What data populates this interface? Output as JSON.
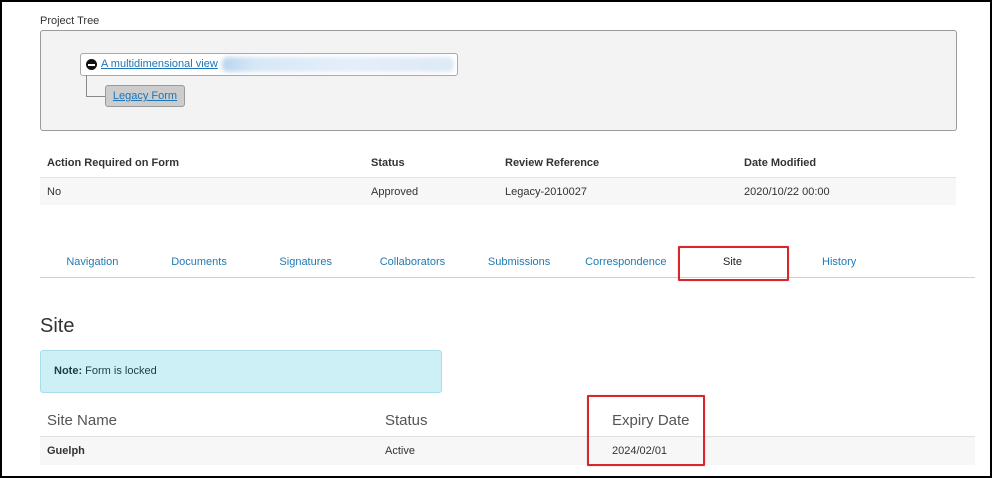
{
  "project_tree": {
    "label": "Project Tree",
    "root": {
      "label": "A multidimensional view",
      "icon": "minus-circle-icon"
    },
    "child": {
      "label": "Legacy Form"
    }
  },
  "form_summary": {
    "headers": [
      "Action Required on Form",
      "Status",
      "Review Reference",
      "Date Modified"
    ],
    "rows": [
      [
        "No",
        "Approved",
        "Legacy-2010027",
        "2020/10/22 00:00"
      ]
    ]
  },
  "tabs": [
    {
      "label": "Navigation",
      "active": false
    },
    {
      "label": "Documents",
      "active": false
    },
    {
      "label": "Signatures",
      "active": false
    },
    {
      "label": "Collaborators",
      "active": false
    },
    {
      "label": "Submissions",
      "active": false
    },
    {
      "label": "Correspondence",
      "active": false
    },
    {
      "label": "Site",
      "active": true
    },
    {
      "label": "History",
      "active": false
    }
  ],
  "site": {
    "title": "Site",
    "note": {
      "label": "Note:",
      "text": "Form is locked"
    },
    "table": {
      "headers": [
        "Site Name",
        "Status",
        "Expiry Date"
      ],
      "rows": [
        [
          "Guelph",
          "Active",
          "2024/02/01"
        ]
      ]
    }
  },
  "colors": {
    "link": "#1b75b8",
    "tab_text": "#1f7ab3",
    "active_tab_text": "#222222",
    "highlight": "#d9262b",
    "note_background": "#cdf0f7",
    "note_border": "#a9dde9"
  }
}
